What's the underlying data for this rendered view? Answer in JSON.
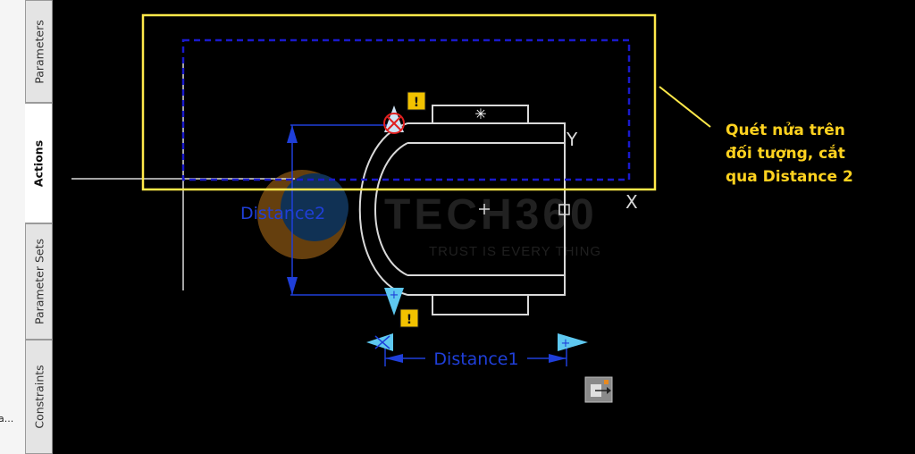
{
  "side_palette": {
    "tabs": [
      {
        "label": "Parameters",
        "active": false
      },
      {
        "label": "Actions",
        "active": true
      },
      {
        "label": "Parameter Sets",
        "active": false
      },
      {
        "label": "Constraints",
        "active": false
      }
    ],
    "truncated_text": "a..."
  },
  "drawing": {
    "parameter_distance1": "Distance1",
    "parameter_distance2": "Distance2",
    "ucs_y_label": "Y",
    "ucs_x_label": "X"
  },
  "watermark": {
    "brand": "TECH360",
    "tagline": "TRUST IS EVERY THING"
  },
  "annotation": {
    "text": "Quét nửa trên\nđối tượng, cắt\nqua Distance 2"
  },
  "colors": {
    "background": "#000000",
    "geometry": "#d9d9d9",
    "parameter_blue": "#1f3fd9",
    "selection_dashed": "#1a1acc",
    "highlight_yellow": "#ffe94a",
    "annotation_text": "#ffd21f",
    "warning_badge": "#f2c200",
    "grip_cyan": "#5ec8f0"
  },
  "icons": [
    "alert-badge-icon",
    "arrow-grip-icon",
    "center-point-icon",
    "block-editor-action-icon"
  ]
}
